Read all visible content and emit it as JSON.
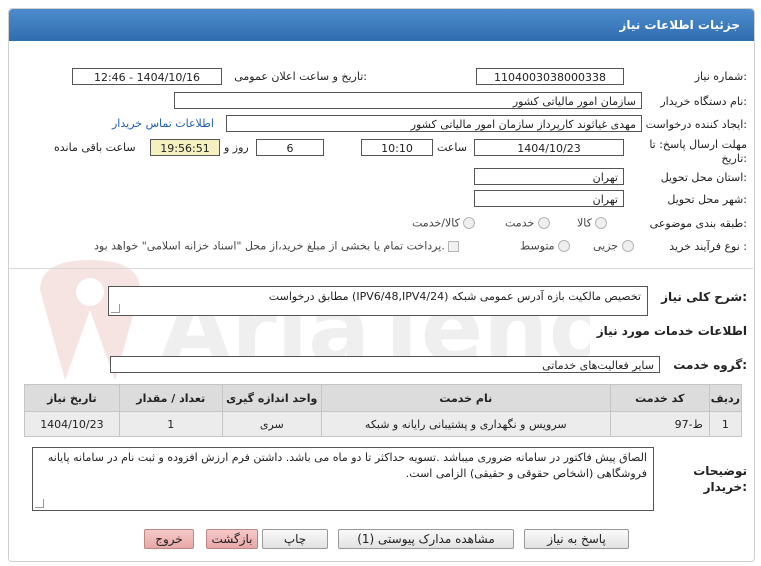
{
  "header": {
    "title": "جزئیات اطلاعات نیاز"
  },
  "fields": {
    "need_number_label": "شماره نیاز:",
    "need_number": "1104003038000338",
    "announce_label": "تاریخ و ساعت اعلان عمومی:",
    "announce_value": "1404/10/16 - 12:46",
    "buyer_org_label": "نام دستگاه خریدار:",
    "buyer_org": "سازمان امور مالیاتی کشور",
    "creator_label": "ایجاد کننده درخواست:",
    "creator": "مهدی غیاثوند کارپرداز سازمان امور مالیاتی کشور",
    "contact_link": "اطلاعات تماس خریدار",
    "deadline_label": "مهلت ارسال پاسخ: تا تاریخ:",
    "deadline_date": "1404/10/23",
    "time_label": "ساعت",
    "deadline_time": "10:10",
    "days_value": "6",
    "days_label": "روز و",
    "remaining_time": "19:56:51",
    "remaining_label": "ساعت باقی مانده",
    "province_label": "استان محل تحویل:",
    "province": "تهران",
    "city_label": "شهر محل تحویل:",
    "city": "تهران",
    "category_label": "طبقه بندی موضوعی:",
    "category_options": [
      "کالا",
      "خدمت",
      "کالا/خدمت"
    ],
    "process_label": "نوع فرآیند خرید :",
    "process_options": [
      "جزیی",
      "متوسط"
    ],
    "payment_note": "پرداخت تمام یا بخشی از مبلغ خرید،از محل \"اسناد خزانه اسلامی\" خواهد بود."
  },
  "description": {
    "label": "شرح کلی نیاز:",
    "value": "تخصیص مالکیت بازه آدرس عمومی شبکه (IPV6/48,IPV4/24) مطابق درخواست"
  },
  "services": {
    "section_title": "اطلاعات خدمات مورد نیاز",
    "group_label": "گروه خدمت:",
    "group_value": "سایر فعالیت‌های خدماتی",
    "columns": [
      "ردیف",
      "کد خدمت",
      "نام خدمت",
      "واحد اندازه گیری",
      "تعداد / مقدار",
      "تاریخ نیاز"
    ],
    "rows": [
      [
        "1",
        "ط-97",
        "سرویس و نگهداری و پشتیبانی رایانه و شبکه",
        "سری",
        "1",
        "1404/10/23"
      ]
    ]
  },
  "notes": {
    "label": "توضیحات خریدار:",
    "value": "الصاق پیش فاکتور در سامانه ضروری میباشد .تسویه حداکثر تا دو ماه می باشد.  داشتن فرم ارزش افزوده و ثبت نام در سامانه پایانه فروشگاهی (اشخاص حقوقی و حقیقی) الزامی است."
  },
  "buttons": {
    "reply": "پاسخ به نیاز",
    "docs": "مشاهده مدارک پیوستی (1)",
    "print": "چاپ",
    "back": "بازگشت",
    "exit": "خروج"
  }
}
